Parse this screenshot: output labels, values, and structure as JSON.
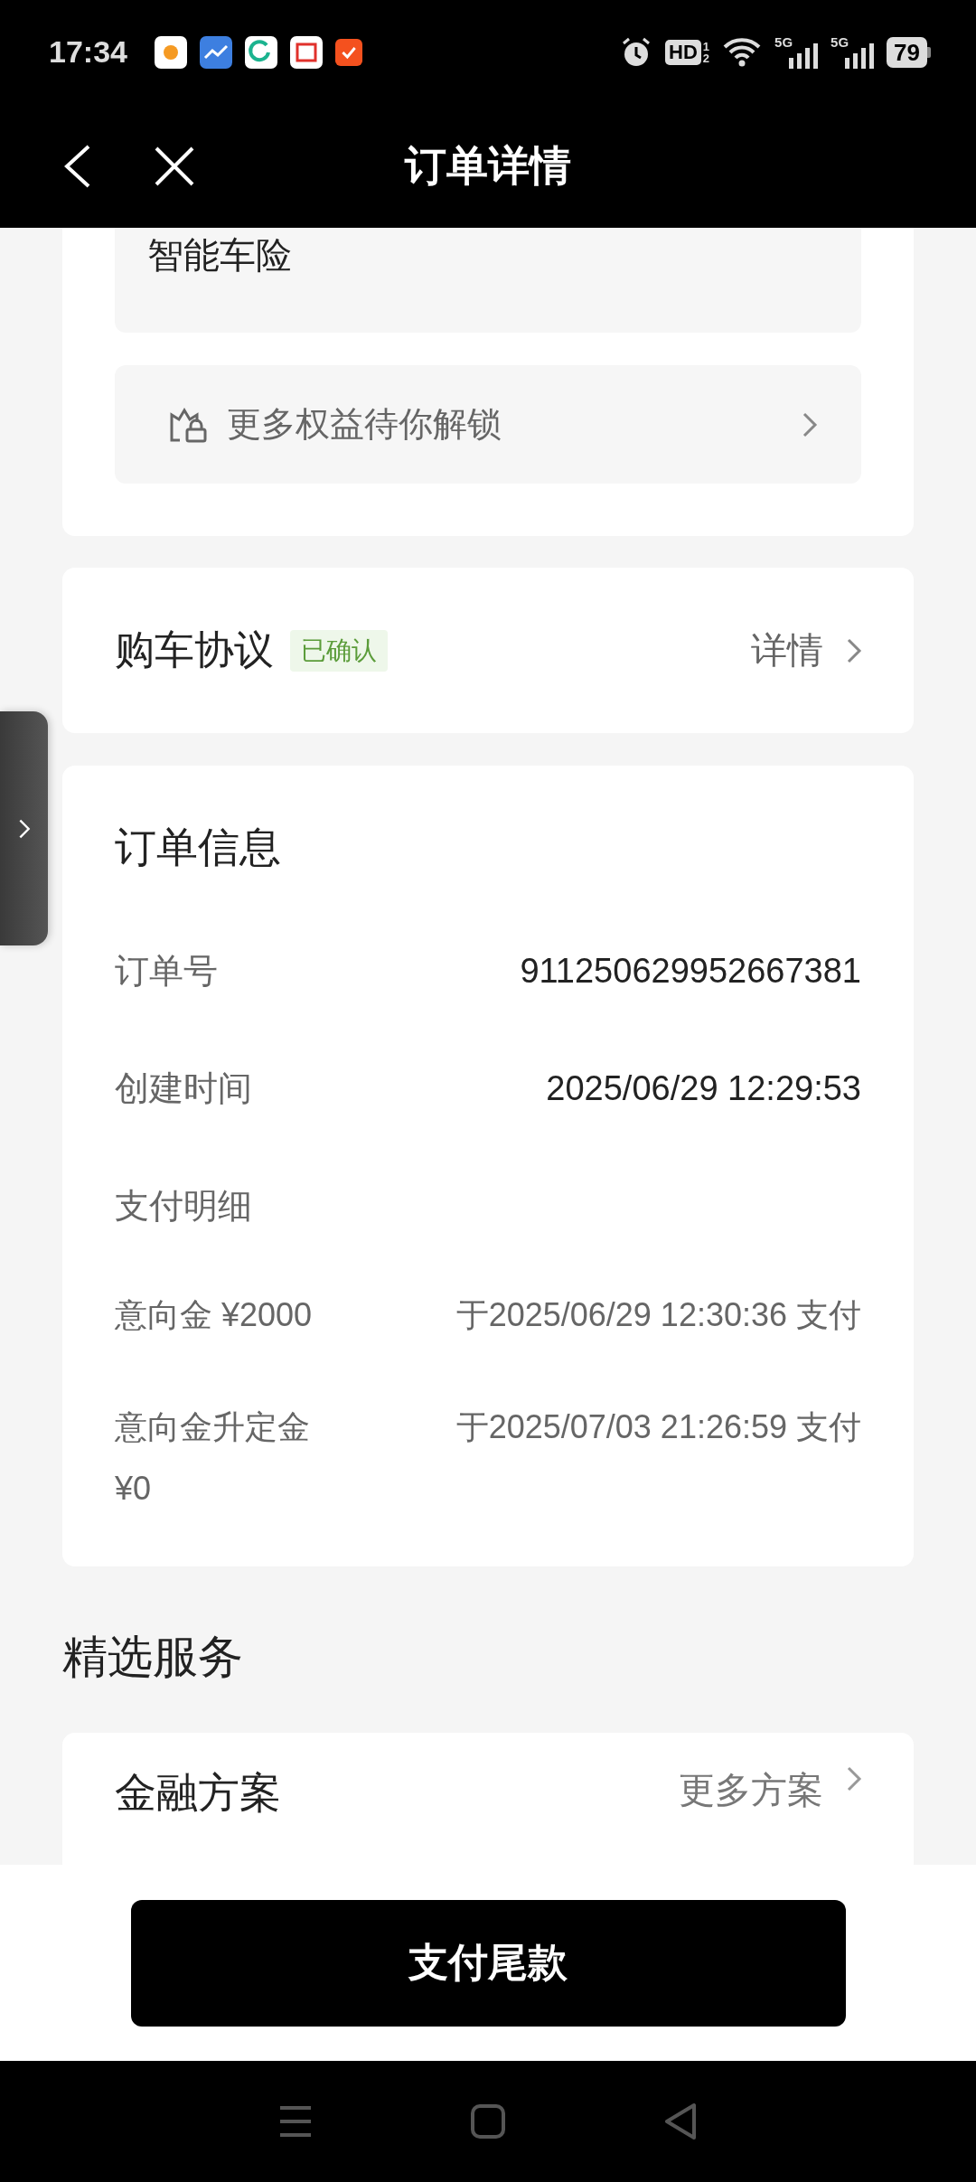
{
  "status_bar": {
    "time": "17:34",
    "hd": "HD",
    "hd_sims": [
      "1",
      "2"
    ],
    "signals": [
      {
        "label": "5G"
      },
      {
        "label": "5G"
      }
    ],
    "battery": "79"
  },
  "nav": {
    "title": "订单详情"
  },
  "benefits_card": {
    "product": "智能车险",
    "unlock": {
      "label": "更多权益待你解锁"
    }
  },
  "agreement": {
    "title": "购车协议",
    "badge": "已确认",
    "link": "详情"
  },
  "order_info": {
    "title": "订单信息",
    "rows": [
      {
        "label": "订单号",
        "value": "911250629952667381"
      },
      {
        "label": "创建时间",
        "value": "2025/06/29 12:29:53"
      },
      {
        "label": "支付明细"
      }
    ],
    "payments": [
      {
        "label": "意向金 ¥2000",
        "value": "于2025/06/29 12:30:36 支付"
      },
      {
        "label": "意向金升定金 ¥0",
        "value": "于2025/07/03 21:26:59 支付"
      }
    ]
  },
  "services": {
    "title": "精选服务",
    "finance": {
      "title": "金融方案",
      "link": "更多方案"
    }
  },
  "pay_button": "支付尾款"
}
